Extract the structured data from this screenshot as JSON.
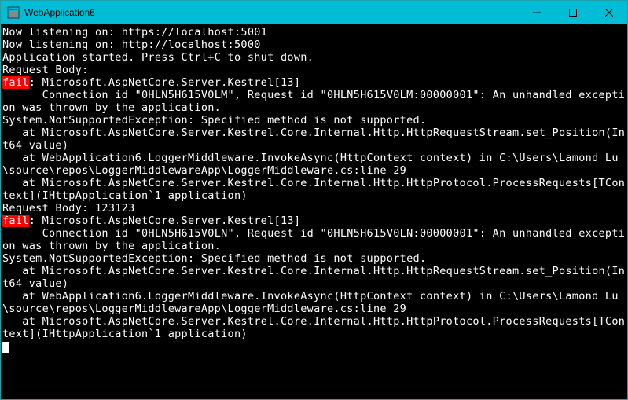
{
  "window": {
    "title": "WebApplication6"
  },
  "colors": {
    "titlebar_bg": "#00bcd4",
    "console_bg": "#000000",
    "console_fg": "#ffffff",
    "fail_bg": "#ff0000"
  },
  "console": {
    "lines": [
      "Now listening on: https://localhost:5001",
      "Now listening on: http://localhost:5000",
      "Application started. Press Ctrl+C to shut down.",
      "Request Body:"
    ],
    "fail_label": "fail",
    "err1_header": ": Microsoft.AspNetCore.Server.Kestrel[13]",
    "err1_body": "      Connection id \"0HLN5H615V0LM\", Request id \"0HLN5H615V0LM:00000001\": An unhandled exception was thrown by the application.\nSystem.NotSupportedException: Specified method is not supported.\n   at Microsoft.AspNetCore.Server.Kestrel.Core.Internal.Http.HttpRequestStream.set_Position(Int64 value)\n   at WebApplication6.LoggerMiddleware.InvokeAsync(HttpContext context) in C:\\Users\\Lamond Lu\\source\\repos\\LoggerMiddlewareApp\\LoggerMiddleware.cs:line 29\n   at Microsoft.AspNetCore.Server.Kestrel.Core.Internal.Http.HttpProtocol.ProcessRequests[TContext](IHttpApplication`1 application)",
    "req2": "Request Body: 123123",
    "err2_header": ": Microsoft.AspNetCore.Server.Kestrel[13]",
    "err2_body": "      Connection id \"0HLN5H615V0LN\", Request id \"0HLN5H615V0LN:00000001\": An unhandled exception was thrown by the application.\nSystem.NotSupportedException: Specified method is not supported.\n   at Microsoft.AspNetCore.Server.Kestrel.Core.Internal.Http.HttpRequestStream.set_Position(Int64 value)\n   at WebApplication6.LoggerMiddleware.InvokeAsync(HttpContext context) in C:\\Users\\Lamond Lu\\source\\repos\\LoggerMiddlewareApp\\LoggerMiddleware.cs:line 29\n   at Microsoft.AspNetCore.Server.Kestrel.Core.Internal.Http.HttpProtocol.ProcessRequests[TContext](IHttpApplication`1 application)"
  }
}
